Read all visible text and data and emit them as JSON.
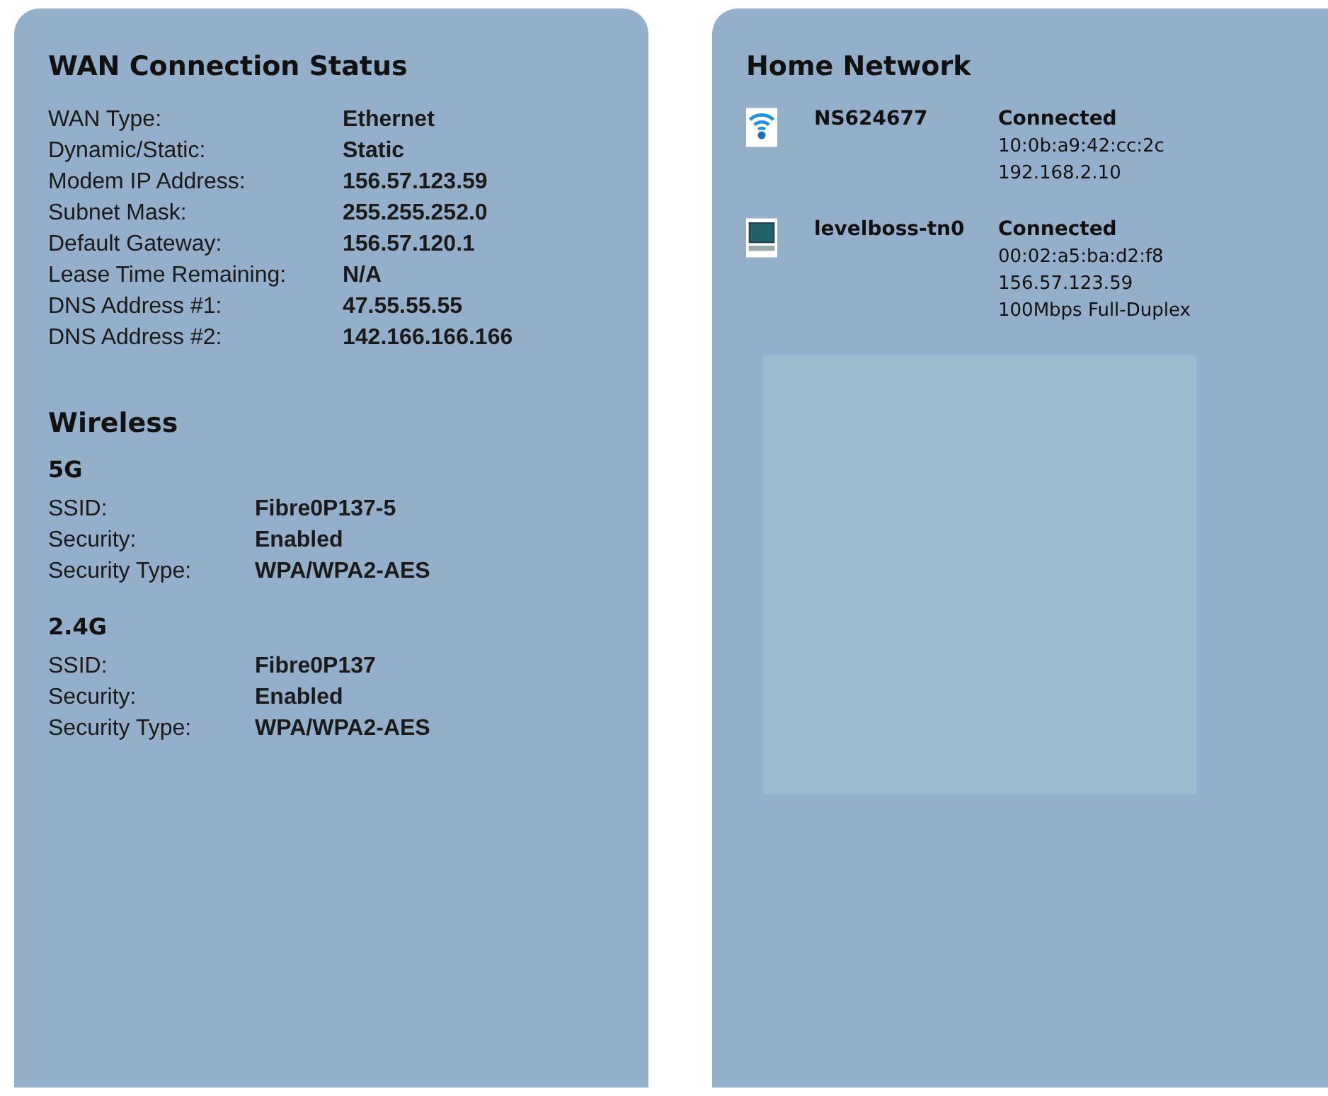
{
  "wan": {
    "title": "WAN Connection Status",
    "rows": [
      {
        "label": "WAN Type:",
        "value": "Ethernet"
      },
      {
        "label": "Dynamic/Static:",
        "value": "Static"
      },
      {
        "label": "Modem IP Address:",
        "value": "156.57.123.59"
      },
      {
        "label": "Subnet Mask:",
        "value": "255.255.252.0"
      },
      {
        "label": "Default Gateway:",
        "value": "156.57.120.1"
      },
      {
        "label": "Lease Time Remaining:",
        "value": "N/A"
      },
      {
        "label": "DNS Address #1:",
        "value": "47.55.55.55"
      },
      {
        "label": "DNS Address #2:",
        "value": "142.166.166.166"
      }
    ]
  },
  "wireless": {
    "title": "Wireless",
    "bands": [
      {
        "name": "5G",
        "rows": [
          {
            "label": "SSID:",
            "value": "Fibre0P137-5"
          },
          {
            "label": "Security:",
            "value": "Enabled"
          },
          {
            "label": "Security Type:",
            "value": "WPA/WPA2-AES"
          }
        ]
      },
      {
        "name": "2.4G",
        "rows": [
          {
            "label": "SSID:",
            "value": "Fibre0P137"
          },
          {
            "label": "Security:",
            "value": "Enabled"
          },
          {
            "label": "Security Type:",
            "value": "WPA/WPA2-AES"
          }
        ]
      }
    ]
  },
  "home_network": {
    "title": "Home Network",
    "devices": [
      {
        "kind": "wireless",
        "name": "NS624677",
        "status": "Connected",
        "details": [
          "10:0b:a9:42:cc:2c",
          "192.168.2.10"
        ]
      },
      {
        "kind": "wired",
        "name": "levelboss-tn0",
        "status": "Connected",
        "details": [
          "00:02:a5:ba:d2:f8",
          "156.57.123.59",
          "100Mbps Full-Duplex"
        ]
      }
    ]
  }
}
